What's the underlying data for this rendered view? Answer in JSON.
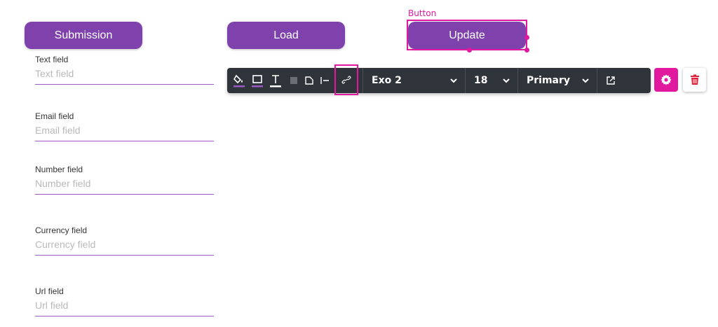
{
  "buttons": {
    "submission": "Submission",
    "load": "Load",
    "update": "Update"
  },
  "selection": {
    "label": "Button"
  },
  "fields": [
    {
      "label": "Text field",
      "placeholder": "Text field"
    },
    {
      "label": "Email field",
      "placeholder": "Email field"
    },
    {
      "label": "Number field",
      "placeholder": "Number field"
    },
    {
      "label": "Currency field",
      "placeholder": "Currency field"
    },
    {
      "label": "Url field",
      "placeholder": "Url field"
    }
  ],
  "toolbar": {
    "font": "Exo 2",
    "size": "18",
    "style": "Primary",
    "icons": [
      "fill-color-icon",
      "border-color-icon",
      "text-color-icon",
      "shadow-icon",
      "corner-icon",
      "align-left-icon",
      "link-icon",
      "external-link-icon",
      "gear-icon",
      "trash-icon"
    ]
  },
  "colors": {
    "button": "#7f42ad",
    "accent": "#e0199e",
    "toolbar": "#2f343a",
    "underline": "#9b59c4",
    "trash": "#e0213a"
  }
}
